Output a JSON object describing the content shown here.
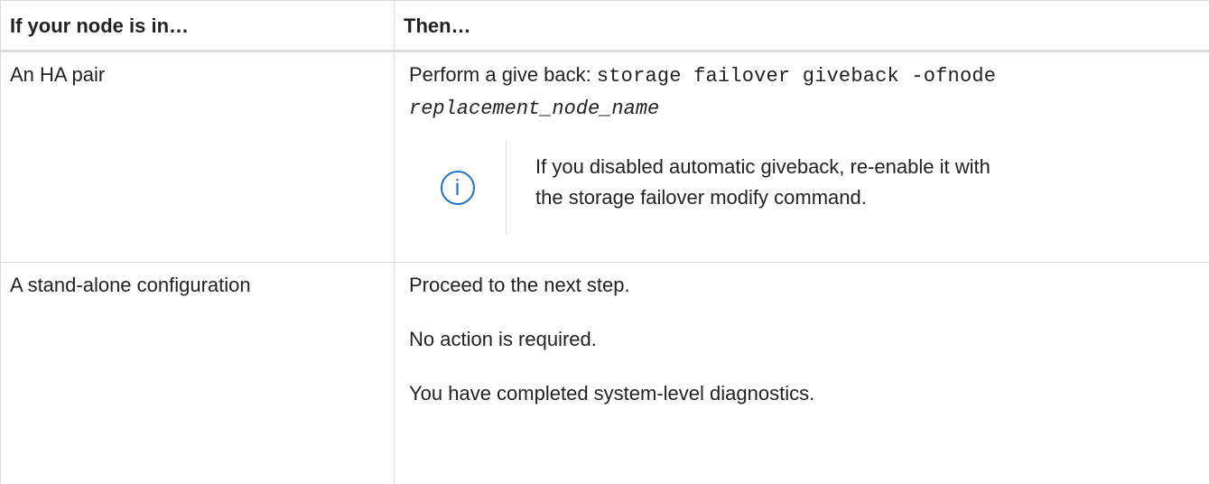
{
  "table": {
    "headers": [
      "If your node is in…",
      "Then…"
    ],
    "rows": [
      {
        "condition": "An HA pair",
        "action_prefix": "Perform a give back: ",
        "command": "storage failover giveback -ofnode",
        "command_arg": "replacement_node_name",
        "note": {
          "icon": "info-icon",
          "icon_glyph": "i",
          "text": "If you disabled automatic giveback, re-enable it with the storage failover modify command."
        }
      },
      {
        "condition": "A stand-alone configuration",
        "paragraphs": [
          "Proceed to the next step.",
          "No action is required.",
          "You have completed system-level diagnostics."
        ]
      }
    ]
  },
  "colors": {
    "border": "#dcdcdc",
    "info_icon": "#1f6fc8",
    "text": "#222222"
  }
}
